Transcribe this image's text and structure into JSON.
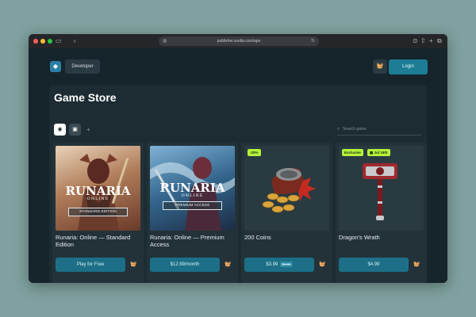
{
  "browser": {
    "url": "publisher.xsolla.com/apo"
  },
  "header": {
    "developer_label": "Developer",
    "login_label": "Login"
  },
  "store": {
    "title": "Game Store",
    "search_placeholder": "Search game"
  },
  "products": [
    {
      "name": "Runaria: Online — Standard Edition",
      "logo_title": "RUNARIA",
      "logo_subtitle": "ONLINE",
      "edition_label": "STANDARD EDITION",
      "button_label": "Play for Free"
    },
    {
      "name": "Runaria: Online — Premium Access",
      "logo_title": "RUNARIA",
      "logo_subtitle": "ONLINE",
      "edition_label": "PREMIUM ACCESS",
      "button_label": "$12.99/month"
    },
    {
      "name": "200 Coins",
      "badge": "-20%",
      "price": "$3.99",
      "old_price": "$5.00"
    },
    {
      "name": "Dragon's Wrath",
      "badge": "Exclusive",
      "date_badge": "Jul 15th",
      "price": "$4.99"
    }
  ],
  "colors": {
    "page_bg": "#7fa19f",
    "accent": "#1c7d95",
    "badge_green": "#b6f23a"
  },
  "icons": [
    "sidebar-toggle-icon",
    "back-icon",
    "shield-icon",
    "reload-icon",
    "share-icon",
    "plus-icon",
    "tabs-icon",
    "basket-icon",
    "steam-icon",
    "epic-icon",
    "search-icon",
    "calendar-icon"
  ]
}
